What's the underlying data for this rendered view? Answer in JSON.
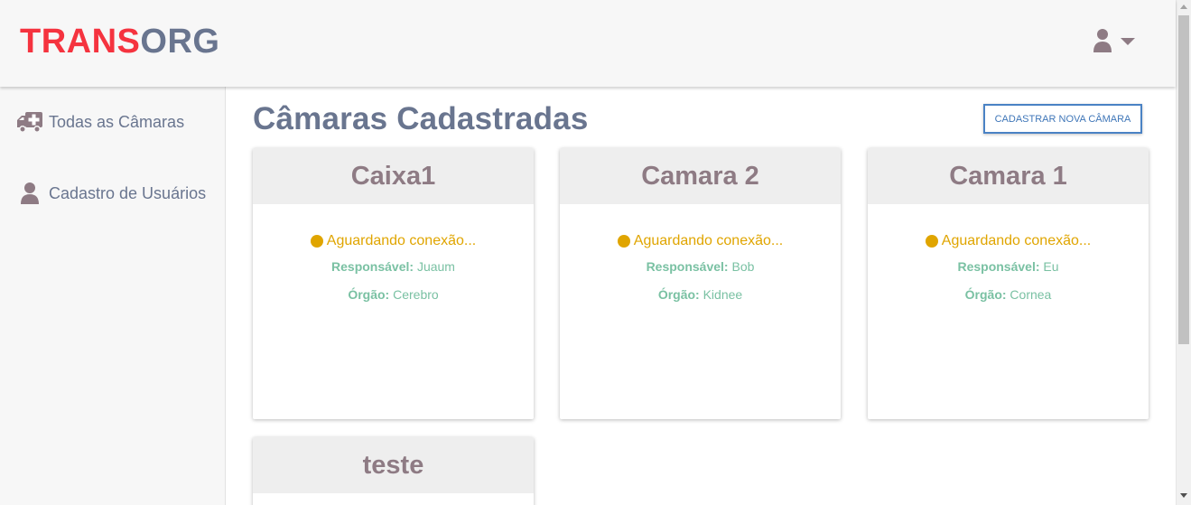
{
  "header": {
    "logo_part1": "TRANS",
    "logo_part2": "ORG",
    "user_icon": "user-icon",
    "dropdown_icon": "caret-down-icon"
  },
  "sidebar": {
    "items": [
      {
        "label": "Todas as Câmaras",
        "icon": "ambulance-icon"
      },
      {
        "label": "Cadastro de Usuários",
        "icon": "user-icon"
      }
    ]
  },
  "main": {
    "title": "Câmaras Cadastradas",
    "new_button_label": "CADASTRAR NOVA CÂMARA",
    "cards": [
      {
        "name": "Caixa1",
        "status": "Aguardando conexão...",
        "responsavel_label": "Responsável:",
        "responsavel": "Juaum",
        "orgao_label": "Órgão:",
        "orgao": "Cerebro"
      },
      {
        "name": "Camara 2",
        "status": "Aguardando conexão...",
        "responsavel_label": "Responsável:",
        "responsavel": "Bob",
        "orgao_label": "Órgão:",
        "orgao": "Kidnee"
      },
      {
        "name": "Camara 1",
        "status": "Aguardando conexão...",
        "responsavel_label": "Responsável:",
        "responsavel": "Eu",
        "orgao_label": "Órgão:",
        "orgao": "Cornea"
      },
      {
        "name": "teste"
      }
    ]
  },
  "colors": {
    "logo_red": "#f5333f",
    "logo_slate": "#69758f",
    "status_pending": "#e0a500",
    "info_green": "#7ac1a3",
    "card_title": "#8e7b84",
    "button_blue": "#4a82c4"
  }
}
